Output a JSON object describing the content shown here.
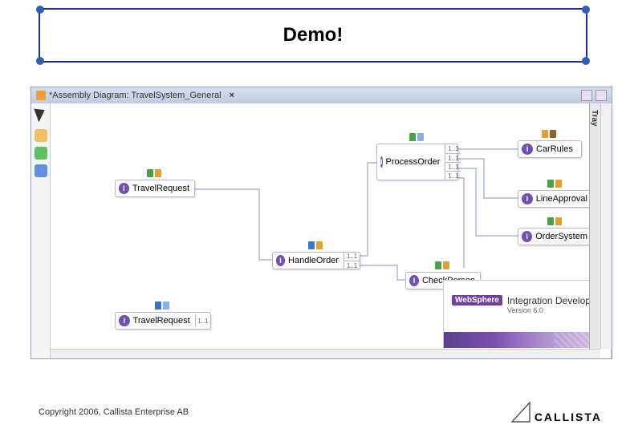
{
  "title": "Demo!",
  "window": {
    "tab_title": "*Assembly Diagram: TravelSystem_General",
    "close_glyph": "×"
  },
  "tray_label": "Tray",
  "nodes": {
    "travel_request_1": {
      "label": "TravelRequest"
    },
    "travel_request_2": {
      "label": "TravelRequest",
      "ports": [
        "1..1"
      ]
    },
    "process_order": {
      "label": "ProcessOrder",
      "ports": [
        "1..1",
        "1..1",
        "1..1",
        "1..1"
      ]
    },
    "handle_order": {
      "label": "HandleOrder",
      "ports": [
        "1..1",
        "1..1"
      ]
    },
    "check_person": {
      "label": "CheckPerson"
    },
    "car_rules": {
      "label": "CarRules"
    },
    "line_approval": {
      "label": "LineApproval"
    },
    "order_system": {
      "label": "OrderSystem"
    }
  },
  "brand": {
    "badge": "WebSphere",
    "product": "Integration Developer",
    "version": "Version 6.0"
  },
  "copyright": "Copyright 2006, Callista Enterprise AB",
  "logo_text": "CALLISTA"
}
